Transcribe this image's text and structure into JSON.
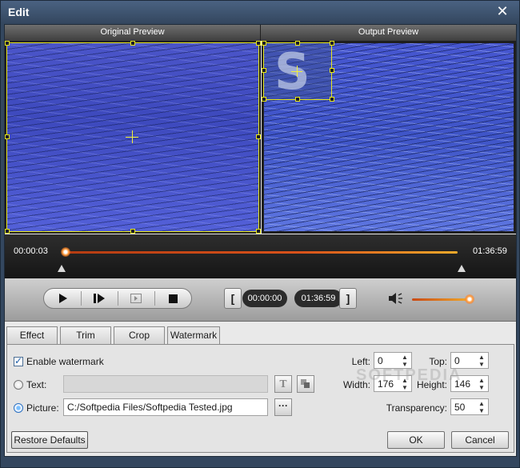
{
  "window": {
    "title": "Edit",
    "close_glyph": "✕"
  },
  "preview": {
    "original_label": "Original Preview",
    "output_label": "Output Preview",
    "watermark_letter": "S"
  },
  "timeline": {
    "start_time": "00:00:03",
    "end_time": "01:36:59"
  },
  "controls": {
    "play_icon": "play-icon",
    "clip_start": "00:00:00",
    "clip_end": "01:36:59",
    "start_bracket": "[",
    "end_bracket": "]",
    "volume_icon": "speaker-icon"
  },
  "tabs": [
    {
      "label": "Effect",
      "active": false
    },
    {
      "label": "Trim",
      "active": false
    },
    {
      "label": "Crop",
      "active": false
    },
    {
      "label": "Watermark",
      "active": true
    }
  ],
  "watermark": {
    "enable_label": "Enable watermark",
    "enable_checked": true,
    "text_label": "Text:",
    "text_value": "",
    "text_font_button": "T",
    "picture_label": "Picture:",
    "picture_value": "C:/Softpedia Files/Softpedia Tested.jpg",
    "browse_button": "···",
    "selected_source": "picture"
  },
  "position": {
    "left_label": "Left:",
    "left_value": "0",
    "top_label": "Top:",
    "top_value": "0",
    "width_label": "Width:",
    "width_value": "176",
    "height_label": "Height:",
    "height_value": "146",
    "transparency_label": "Transparency:",
    "transparency_value": "50"
  },
  "footer": {
    "restore_label": "Restore Defaults",
    "ok_label": "OK",
    "cancel_label": "Cancel"
  },
  "overlay": {
    "softpedia_watermark": "SOFTPEDIA"
  },
  "colors": {
    "title_bar": "#34475f",
    "accent_orange": "#f0a92a",
    "selection_yellow": "#e6e61a"
  }
}
